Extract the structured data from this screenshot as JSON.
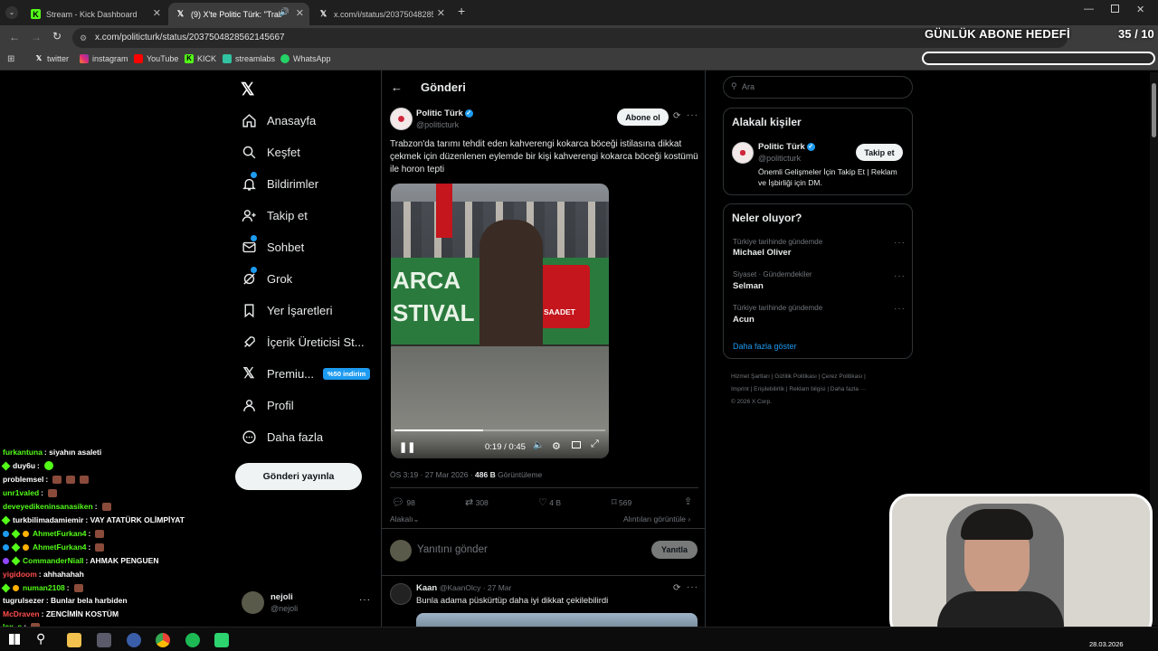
{
  "browser": {
    "tabs": [
      {
        "title": "Stream - Kick Dashboard",
        "active": false
      },
      {
        "title": "(9) X'te Politic Türk: \"Trabzo",
        "active": true
      },
      {
        "title": "x.com/i/status/2037504828562",
        "active": false
      }
    ],
    "url": "x.com/politicturk/status/2037504828562145667",
    "bookmarks": [
      "twitter",
      "instagram",
      "YouTube",
      "KICK",
      "streamlabs",
      "WhatsApp"
    ]
  },
  "overlay": {
    "goal_label": "GÜNLÜK ABONE HEDEFİ",
    "goal_count": "35 / 10"
  },
  "nav": {
    "items": [
      "Anasayfa",
      "Keşfet",
      "Bildirimler",
      "Takip et",
      "Sohbet",
      "Grok",
      "Yer İşaretleri",
      "İçerik Üreticisi St...",
      "Premiu...",
      "Profil",
      "Daha fazla"
    ],
    "premium_badge": "%50 indirim",
    "post_button": "Gönderi yayınla",
    "account_name": "nejoli",
    "account_handle": "@nejoli"
  },
  "post": {
    "header": "Gönderi",
    "author": "Politic Türk",
    "handle": "@politicturk",
    "subscribe": "Abone ol",
    "text": "Trabzon'da tarımı tehdit eden kahverengi kokarca böceği istilasına dikkat çekmek için düzenlenen eylemde bir kişi kahverengi kokarca böceği kostümü ile horon tepti",
    "video_time": "0:19 / 0:45",
    "video_progress": 0.42,
    "banner_left": "ARCA",
    "banner_left2": "STIVAL",
    "banner_right": "SAADET",
    "meta_time": "ÖS 3:19 · 27 Mar 2026 ·",
    "views_count": "486 B",
    "views_label": "Görüntüleme",
    "replies": "98",
    "reposts": "308",
    "likes": "4 B",
    "bookmarks": "569",
    "related": "Alakalı",
    "quotes": "Alıntıları görüntüle",
    "reply_placeholder": "Yanıtını gönder",
    "reply_button": "Yanıtla"
  },
  "reply": {
    "author": "Kaan",
    "handle": "@KaanOlcy · 27 Mar",
    "text": "Bunla adama püskürtüp daha iyi dikkat çekilebilirdi"
  },
  "right": {
    "search_placeholder": "Ara",
    "related_title": "Alakalı kişiler",
    "person_name": "Politic Türk",
    "person_handle": "@politicturk",
    "follow": "Takip et",
    "person_bio": "Önemli Gelişmeler İçin Takip Et | Reklam ve İşbirliği için DM.",
    "trends_title": "Neler oluyor?",
    "trends": [
      {
        "category": "Türkiye tarihinde gündemde",
        "name": "Michael Oliver"
      },
      {
        "category": "Siyaset · Gündemdekiler",
        "name": "Selman"
      },
      {
        "category": "Türkiye tarihinde gündemde",
        "name": "Acun"
      }
    ],
    "show_more": "Daha fazla göster",
    "footer_line1": "Hizmet Şartları  |  Gizlilik Politikası  |  Çerez Politikası  |",
    "footer_line2": "Imprint  |  Erişilebilirlik  |  Reklam bilgisi  |  Daha fazla ···",
    "footer_line3": "© 2026 X Corp."
  },
  "chat": [
    {
      "user": "furkantuna",
      "msg": ": siyahın asaleti",
      "color": "#53fc18"
    },
    {
      "user": "duy6u",
      "msg": ":",
      "color": "#fff"
    },
    {
      "user": "problemsel",
      "msg": ":",
      "color": "#fff"
    },
    {
      "user": "unr1valed",
      "msg": ":",
      "color": "#53fc18"
    },
    {
      "user": "deveyedikeninsanasiken",
      "msg": ":",
      "color": "#53fc18"
    },
    {
      "user": "turkbilimadamiemir",
      "msg": ": VAY ATATÜRK OLİMPİYAT",
      "color": "#fff"
    },
    {
      "user": "AhmetFurkan4",
      "msg": ":",
      "color": "#53fc18"
    },
    {
      "user": "AhmetFurkan4",
      "msg": ":",
      "color": "#53fc18"
    },
    {
      "user": "CommanderNiall",
      "msg": ": AHMAK PENGUEN",
      "color": "#53fc18"
    },
    {
      "user": "yigidoom",
      "msg": ": ahhahahah",
      "color": "#ff4d4d"
    },
    {
      "user": "numan2108",
      "msg": ":",
      "color": "#53fc18"
    },
    {
      "user": "tugrulsezer",
      "msg": ": Bunlar bela harbiden",
      "color": "#fff"
    },
    {
      "user": "McDraven",
      "msg": ": ZENCİMİN KOSTÜM",
      "color": "#ff4d4d"
    },
    {
      "user": "lex_s",
      "msg": ":",
      "color": "#fff"
    }
  ],
  "taskbar": {
    "date": "28.03.2026"
  }
}
